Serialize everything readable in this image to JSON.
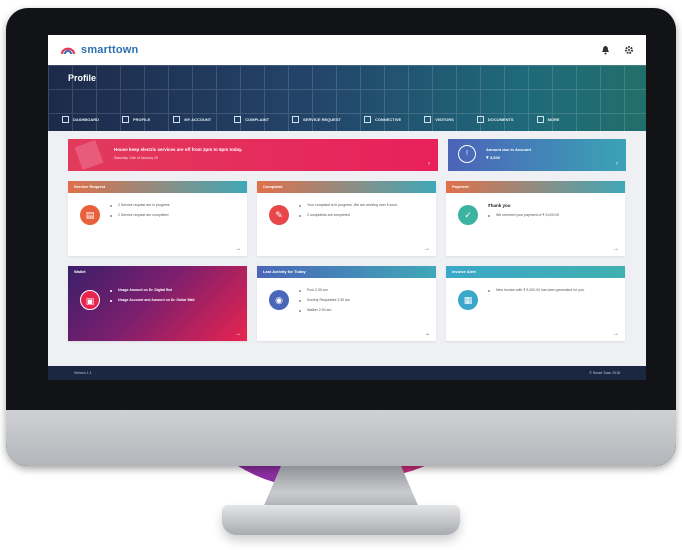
{
  "app": {
    "brand": "smarttown",
    "page_title": "Profile"
  },
  "topbar": {
    "icons": [
      "bell-icon",
      "gear-icon"
    ]
  },
  "nav": {
    "items": [
      {
        "label": "DASHBOARD",
        "icon": "dashboard-icon"
      },
      {
        "label": "PROFILE",
        "icon": "user-icon"
      },
      {
        "label": "MY ACCOUNT",
        "icon": "building-icon"
      },
      {
        "label": "COMPLAINT",
        "icon": "complaint-icon"
      },
      {
        "label": "SERVICE REQUEST",
        "icon": "service-icon"
      },
      {
        "label": "CONNECTIVE",
        "icon": "connect-icon"
      },
      {
        "label": "VISITORS",
        "icon": "visitor-icon"
      },
      {
        "label": "DOCUMENTS",
        "icon": "document-icon"
      },
      {
        "label": "MORE",
        "icon": "more-icon"
      }
    ]
  },
  "alert": {
    "message": "House keep electric services are off from 2pm to 5pm today.",
    "sub": "Saturday 14th of January 20"
  },
  "account": {
    "label": "Amount due in Account",
    "value": "₹ 3,000"
  },
  "cards": [
    {
      "title": "Service Request",
      "icon": "service-request-icon",
      "color": "#e8603c",
      "lines": [
        "2 Service request are in progress",
        "2 Service request are completed"
      ]
    },
    {
      "title": "Complaint",
      "icon": "complaint-icon",
      "color": "#e8474a",
      "lines": [
        "Your complaint is in progress. We are working over it soon.",
        "2 complaints are completed"
      ]
    },
    {
      "title": "Payment",
      "icon": "check-icon",
      "color": "#3bb3a0",
      "heading": "Thank you",
      "lines": [
        "We received your payment of ₹ 5,000.00"
      ]
    },
    {
      "title": "Wallet",
      "icon": "wallet-icon",
      "color": "#e8244f",
      "lines": [
        "Usage Amount on Dr. Digital Bot",
        "Usage Account and Amount on Dr. Dollar Wall"
      ]
    },
    {
      "title": "Last Activity for Today",
      "icon": "car-icon",
      "color": "#4a66b8",
      "lines": [
        "Pool 2:30 am",
        "Society Requested 2:30 am",
        "Walker 2:30 am"
      ]
    },
    {
      "title": "Invoice Alert",
      "icon": "invoice-icon",
      "color": "#3aa8c8",
      "lines": [
        "New Invoice with ₹ 5,000.00 has been generated for you."
      ]
    }
  ],
  "footer": {
    "left": "Version 1.1",
    "right": "© Smart Town 2018"
  }
}
